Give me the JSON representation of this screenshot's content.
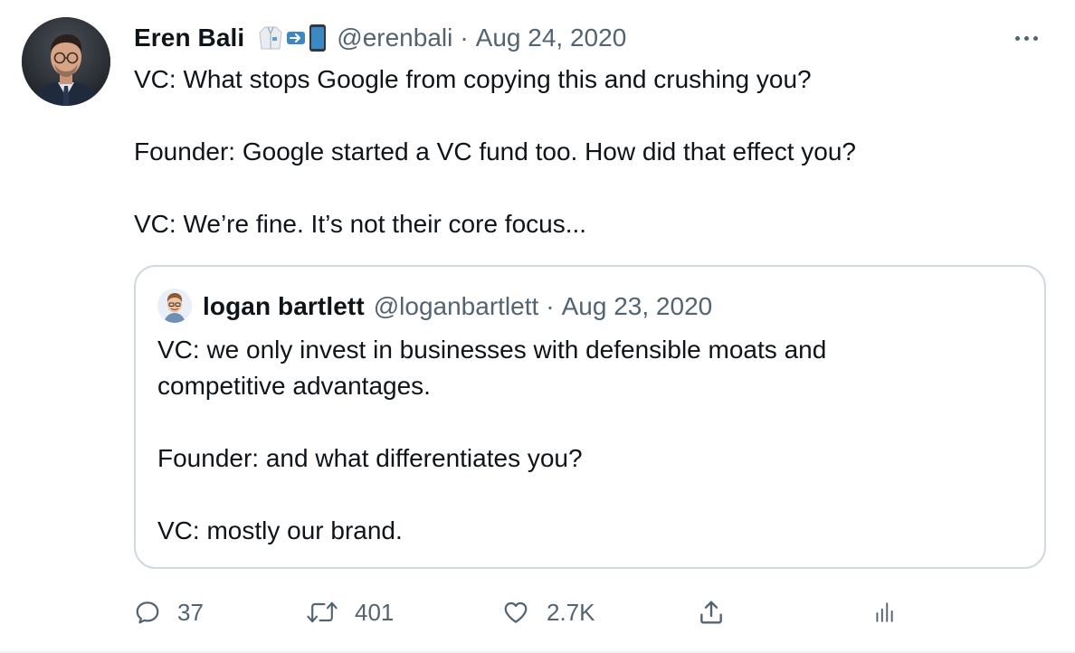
{
  "tweet": {
    "author": {
      "name": "Eren Bali",
      "emoji_icons": [
        "lab-coat-icon",
        "arrow-right-icon",
        "mobile-phone-icon"
      ],
      "handle": "@erenbali",
      "separator": "·",
      "date": "Aug 24, 2020"
    },
    "text": [
      "VC: What stops Google from copying this and crushing you?",
      "Founder: Google started a VC fund too. How did that effect you?",
      "VC: We’re fine. It’s not their core focus..."
    ],
    "quoted": {
      "author": {
        "name": "logan bartlett",
        "handle": "@loganbartlett",
        "separator": "·",
        "date": "Aug 23, 2020"
      },
      "text": [
        "VC: we only invest in businesses with defensible moats and competitive advantages.",
        "Founder: and what differentiates you?",
        "VC: mostly our brand."
      ]
    },
    "actions": {
      "replies": "37",
      "retweets": "401",
      "likes": "2.7K"
    }
  },
  "colors": {
    "text_primary": "#0f1419",
    "text_secondary": "#536471",
    "border": "#cfd9de",
    "emoji_blue": "#3b88c3"
  }
}
